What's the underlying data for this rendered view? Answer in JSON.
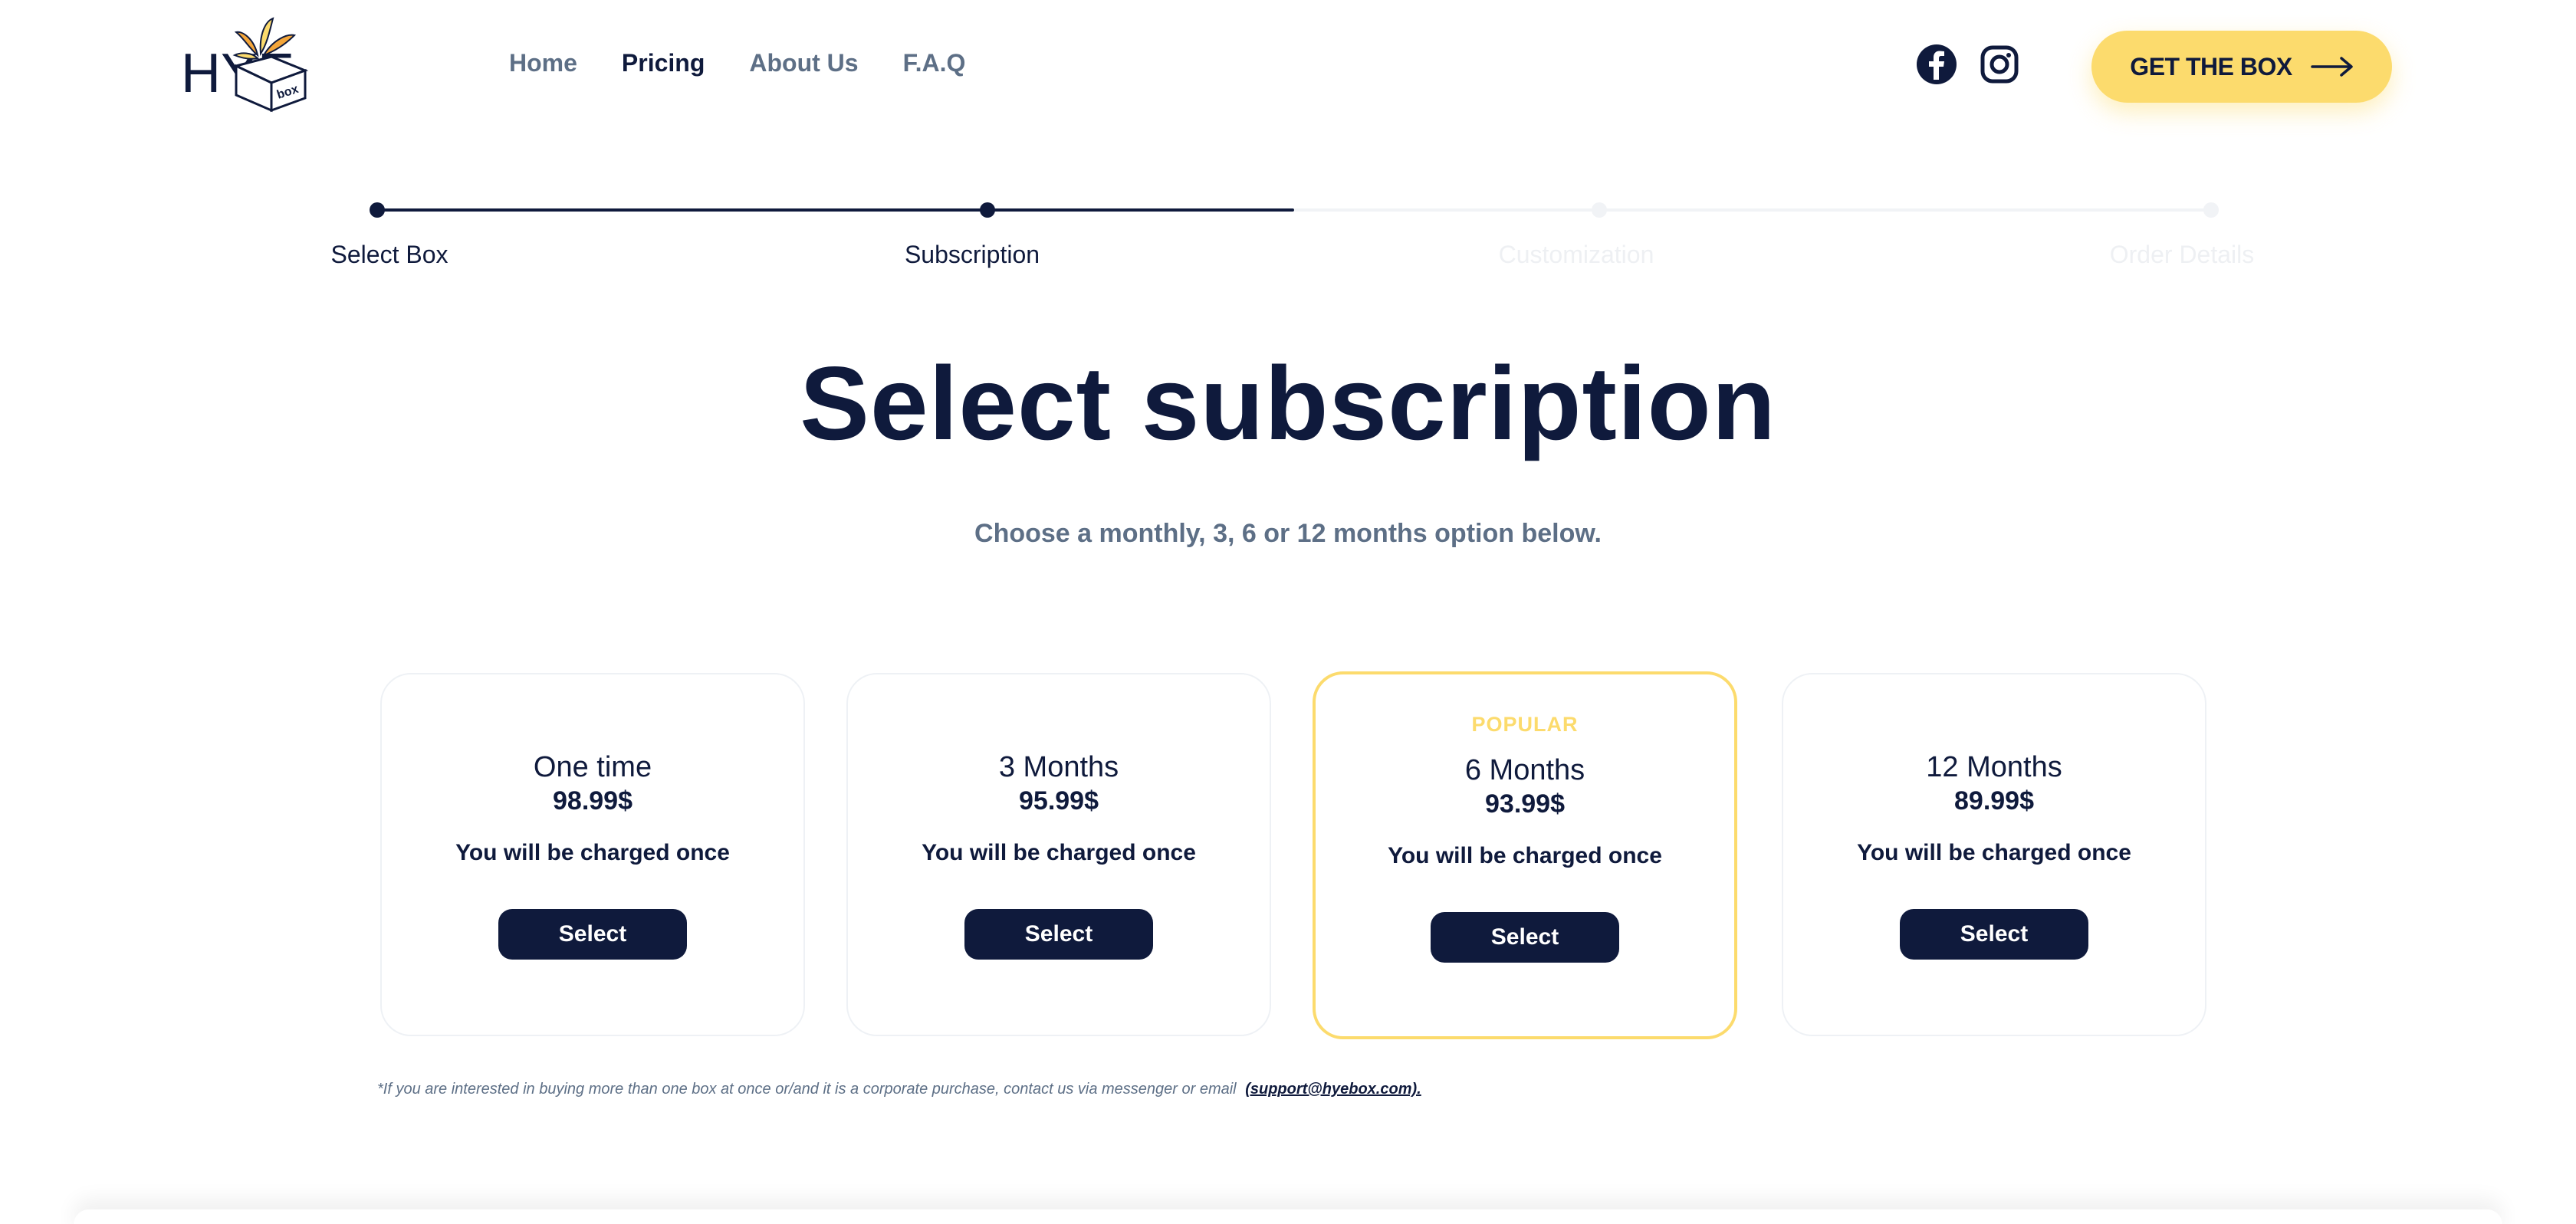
{
  "brand": {
    "logo_text": "HYE",
    "box_text": "box",
    "accent_color": "#fcdb6d",
    "navy_color": "#0f1a3c",
    "muted_color": "#5d6f86"
  },
  "nav": {
    "items": [
      {
        "label": "Home",
        "active": false
      },
      {
        "label": "Pricing",
        "active": true
      },
      {
        "label": "About Us",
        "active": false
      },
      {
        "label": "F.A.Q",
        "active": false
      }
    ]
  },
  "social": {
    "icons": [
      "facebook-icon",
      "instagram-icon"
    ]
  },
  "cta": {
    "label": "GET THE BOX",
    "icon": "arrow-right-icon"
  },
  "stepper": {
    "steps": [
      {
        "label": "Select Box",
        "status": "complete"
      },
      {
        "label": "Subscription",
        "status": "current"
      },
      {
        "label": "Customization",
        "status": "upcoming"
      },
      {
        "label": "Order Details",
        "status": "upcoming"
      }
    ]
  },
  "page": {
    "title": "Select subscription",
    "subtitle": "Choose a monthly, 3, 6 or 12 months option below."
  },
  "plans": [
    {
      "name": "One time",
      "price": "98.99$",
      "note": "You will be charged once",
      "button": "Select",
      "badge": "",
      "popular": false
    },
    {
      "name": "3 Months",
      "price": "95.99$",
      "note": "You will be charged once",
      "button": "Select",
      "badge": "",
      "popular": false
    },
    {
      "name": "6 Months",
      "price": "93.99$",
      "note": "You will be charged once",
      "button": "Select",
      "badge": "POPULAR",
      "popular": true
    },
    {
      "name": "12 Months",
      "price": "89.99$",
      "note": "You will be charged once",
      "button": "Select",
      "badge": "",
      "popular": false
    }
  ],
  "footnote": {
    "text": "*If you are interested in buying more than one box at once or/and it is a corporate purchase, contact us via messenger or email",
    "link": "(support@hyebox.com)."
  }
}
